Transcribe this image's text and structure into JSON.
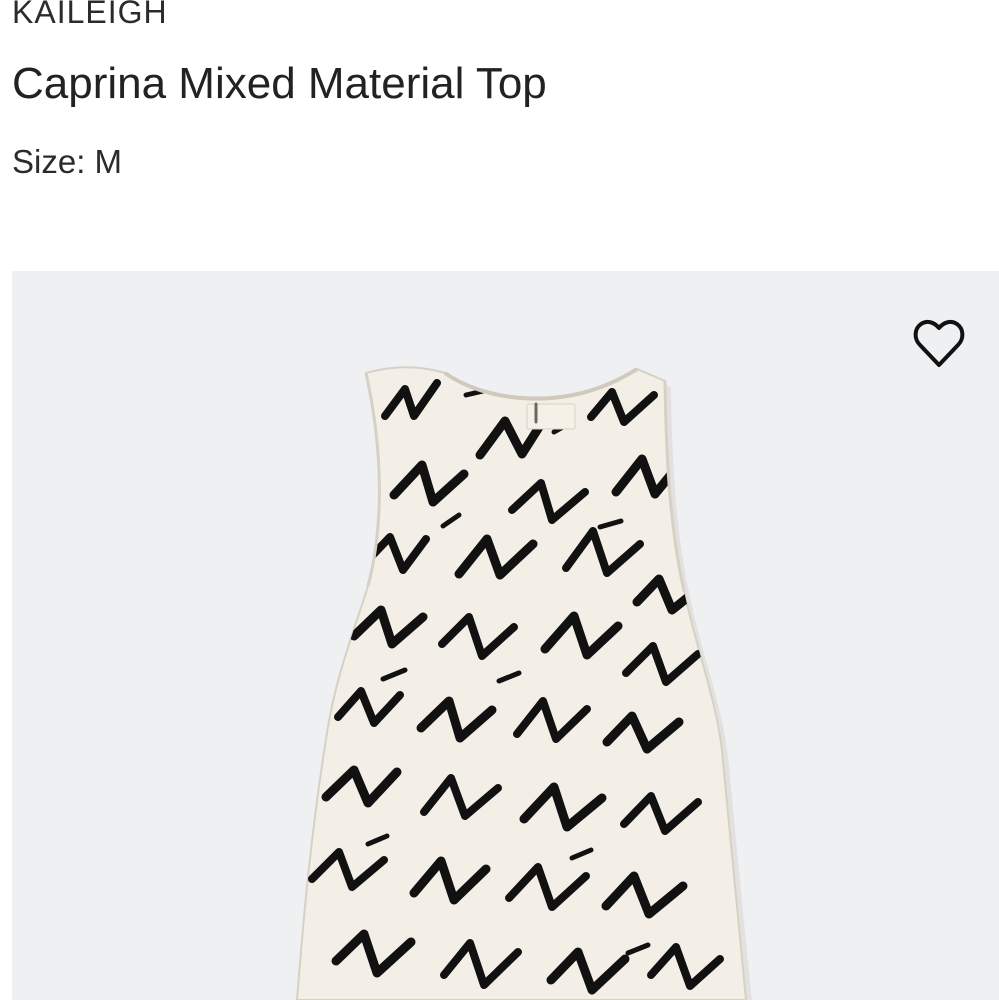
{
  "product": {
    "brand": "KAILEIGH",
    "name": "Caprina Mixed Material Top",
    "size_label": "Size: M"
  },
  "gallery": {
    "favorite_icon": "heart-outline-icon",
    "image_subject": "sleeveless-printed-top"
  },
  "colors": {
    "card_background": "#eef0f2",
    "garment_base": "#f4efe6",
    "print_ink": "#111111"
  }
}
